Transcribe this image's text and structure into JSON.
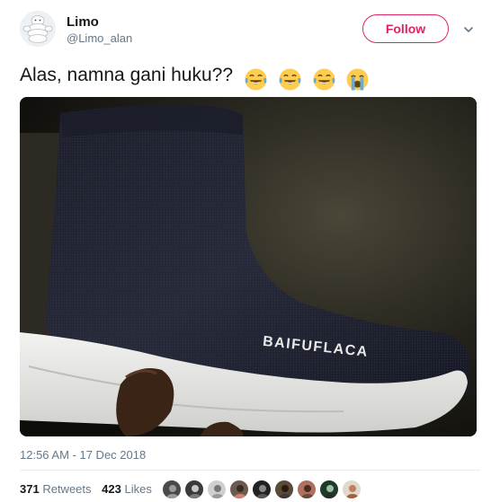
{
  "tweet": {
    "author": {
      "display_name": "Limo",
      "handle": "@Limo_alan",
      "avatar_icon": "michelin-man-avatar"
    },
    "follow_label": "Follow",
    "text": "Alas, namna gani huku??",
    "emojis": [
      "face-with-tears-of-joy",
      "face-with-tears-of-joy",
      "face-with-tears-of-joy",
      "loudly-crying-face"
    ],
    "photo": {
      "label_on_shoe": "BAIFUFLACA"
    },
    "timestamp": "12:56 AM - 17 Dec 2018",
    "stats": {
      "retweets_count": "371",
      "retweets_label": "Retweets",
      "likes_count": "423",
      "likes_label": "Likes"
    }
  },
  "colors": {
    "follow_accent": "#e0245e",
    "secondary_text": "#657786",
    "primary_text": "#14171a"
  }
}
